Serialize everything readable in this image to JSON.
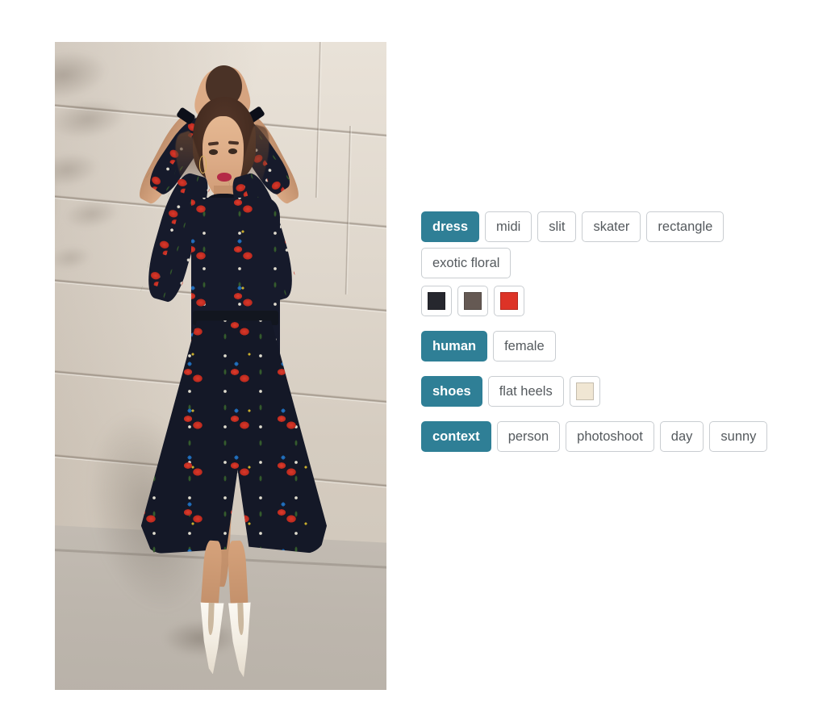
{
  "photo": {
    "alt": "Woman in navy exotic floral midi shirt dress with front slit and white pointed flat heel ankle boots, standing against a sunlit stone wall",
    "subject": "female model",
    "garment": "floral midi dress",
    "footwear": "white pointed ankle boots",
    "setting": "stone wall exterior, daylight"
  },
  "annotations": {
    "groups": [
      {
        "id": "dress",
        "label": "dress",
        "rows": [
          {
            "type": "text",
            "tags": [
              "midi",
              "slit",
              "skater",
              "rectangle",
              "exotic floral"
            ]
          },
          {
            "type": "color",
            "swatches": [
              {
                "name": "black",
                "hex": "#26272e"
              },
              {
                "name": "taupe-brown",
                "hex": "#655953"
              },
              {
                "name": "red",
                "hex": "#dd3327"
              }
            ]
          }
        ]
      },
      {
        "id": "human",
        "label": "human",
        "rows": [
          {
            "type": "text",
            "tags": [
              "female"
            ]
          }
        ]
      },
      {
        "id": "shoes",
        "label": "shoes",
        "rows": [
          {
            "type": "mixed",
            "tags": [
              "flat heels"
            ],
            "swatches": [
              {
                "name": "cream",
                "hex": "#f0e6d3"
              }
            ]
          }
        ]
      },
      {
        "id": "context",
        "label": "context",
        "rows": [
          {
            "type": "text",
            "tags": [
              "person",
              "photoshoot",
              "day",
              "sunny"
            ]
          }
        ]
      }
    ]
  },
  "theme": {
    "label_background": "#2f7f96",
    "label_text": "#ffffff",
    "tag_background": "#ffffff",
    "tag_text": "#555a5e",
    "tag_border": "#c9cdd1",
    "page_background": "#ffffff"
  }
}
